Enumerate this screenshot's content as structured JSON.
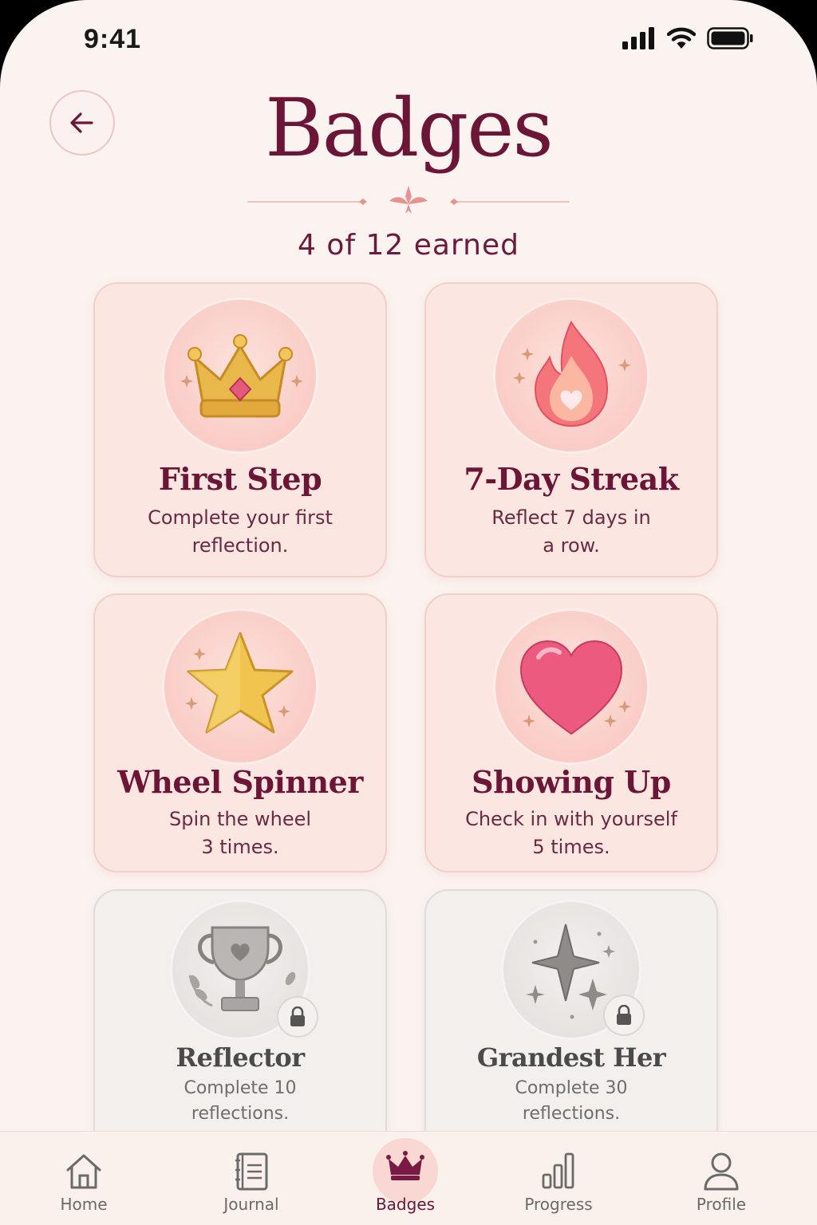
{
  "status": {
    "time": "9:41"
  },
  "header": {
    "title": "Badges",
    "subtitle": "4 of 12 earned"
  },
  "badges": [
    {
      "title": "First Step",
      "line1": "Complete your first",
      "line2": "reflection.",
      "icon": "crown-icon",
      "locked": false
    },
    {
      "title": "7-Day Streak",
      "line1": "Reflect 7 days in",
      "line2": "a row.",
      "icon": "flame-icon",
      "locked": false
    },
    {
      "title": "Wheel Spinner",
      "line1": "Spin the wheel",
      "line2": "3 times.",
      "icon": "star-icon",
      "locked": false
    },
    {
      "title": "Showing Up",
      "line1": "Check in with yourself",
      "line2": "5 times.",
      "icon": "heart-icon",
      "locked": false
    },
    {
      "title": "Reflector",
      "line1": "Complete 10",
      "line2": "reflections.",
      "icon": "trophy-icon",
      "locked": true
    },
    {
      "title": "Grandest Her",
      "line1": "Complete 30",
      "line2": "reflections.",
      "icon": "sparkle-icon",
      "locked": true
    }
  ],
  "tabs": [
    {
      "label": "Home",
      "icon": "home-icon"
    },
    {
      "label": "Journal",
      "icon": "journal-icon"
    },
    {
      "label": "Badges",
      "icon": "crown-icon",
      "active": true
    },
    {
      "label": "Progress",
      "icon": "bar-chart-icon"
    },
    {
      "label": "Profile",
      "icon": "person-icon"
    }
  ],
  "colors": {
    "accent": "#6b1537",
    "background": "#fbf3ef",
    "card": "#fbe6e2",
    "locked_card": "#f2efec"
  }
}
